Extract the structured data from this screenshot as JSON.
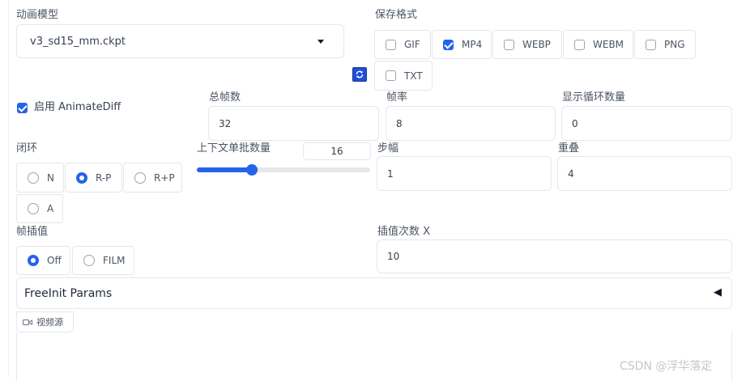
{
  "model": {
    "label": "动画模型",
    "value": "v3_sd15_mm.ckpt"
  },
  "save_format": {
    "label": "保存格式",
    "options": [
      {
        "label": "GIF",
        "checked": false
      },
      {
        "label": "MP4",
        "checked": true
      },
      {
        "label": "WEBP",
        "checked": false
      },
      {
        "label": "WEBM",
        "checked": false
      },
      {
        "label": "PNG",
        "checked": false
      },
      {
        "label": "TXT",
        "checked": false
      }
    ]
  },
  "enable": {
    "label": "启用 AnimateDiff",
    "checked": true
  },
  "total_frames": {
    "label": "总帧数",
    "value": "32"
  },
  "fps": {
    "label": "帧率",
    "value": "8"
  },
  "loop_count": {
    "label": "显示循环数量",
    "value": "0"
  },
  "closed_loop": {
    "label": "闭环",
    "options": [
      {
        "label": "N",
        "selected": false
      },
      {
        "label": "R-P",
        "selected": true
      },
      {
        "label": "R+P",
        "selected": false
      },
      {
        "label": "A",
        "selected": false
      }
    ]
  },
  "context_batch": {
    "label": "上下文单批数量",
    "value": "16",
    "fraction": 0.32
  },
  "stride": {
    "label": "步幅",
    "value": "1"
  },
  "overlap": {
    "label": "重叠",
    "value": "4"
  },
  "interp": {
    "label": "帧插值",
    "options": [
      {
        "label": "Off",
        "selected": true
      },
      {
        "label": "FILM",
        "selected": false
      }
    ]
  },
  "interp_x": {
    "label": "插值次数 X",
    "value": "10"
  },
  "freeinit": {
    "label": "FreeInit Params",
    "arrow": "◀"
  },
  "video_source": {
    "label": "视频源"
  },
  "watermark": "CSDN @浮华落定",
  "colors": {
    "accent": "#2563eb",
    "border": "#e5e7eb"
  }
}
